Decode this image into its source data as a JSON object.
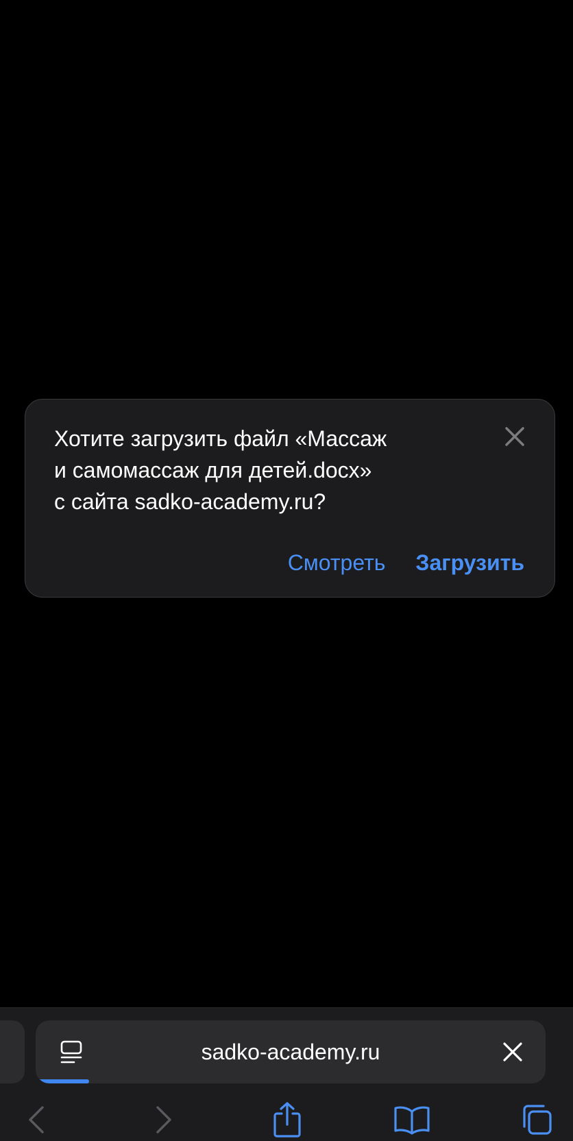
{
  "dialog": {
    "message_lines": [
      "Хотите загрузить файл «Массаж",
      "и самомассаж для детей.docx»",
      "с сайта sadko-academy.ru?"
    ],
    "view_label": "Смотреть",
    "download_label": "Загрузить",
    "close_icon": "close-icon"
  },
  "address_bar": {
    "url": "sadko-academy.ru",
    "reader_icon": "page-menu-icon",
    "clear_icon": "close-icon",
    "load_progress_percent": 10
  },
  "toolbar": {
    "icons": [
      "back-chevron-icon",
      "forward-chevron-icon",
      "share-icon",
      "bookmarks-book-icon",
      "tabs-icon"
    ]
  },
  "colors": {
    "accent": "#4a8ff3",
    "dialog_bg": "#1c1c1e",
    "bar_bg": "#1c1c1e",
    "pill_bg": "#2c2c2e",
    "disabled_icon": "#5a5a5e",
    "progress": "#3f86f0"
  }
}
